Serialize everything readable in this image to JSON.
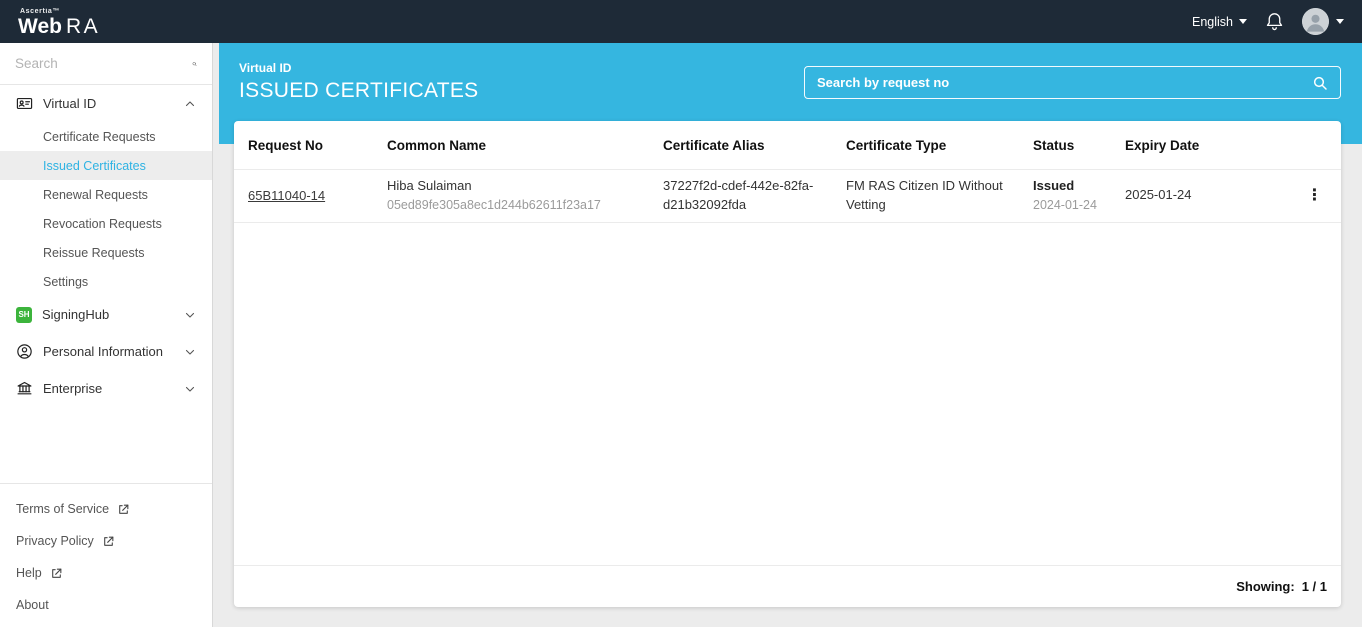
{
  "topbar": {
    "brand_ascertia": "Ascertia™",
    "brand_web": "Web",
    "brand_ra": "RA",
    "language_label": "English"
  },
  "sidebar": {
    "search_placeholder": "Search",
    "menu": {
      "virtual_id": {
        "label": "Virtual ID"
      },
      "signinghub": {
        "label": "SigningHub",
        "badge": "SH"
      },
      "personal_information": {
        "label": "Personal Information"
      },
      "enterprise": {
        "label": "Enterprise"
      }
    },
    "virtual_id_items": [
      {
        "label": "Certificate Requests",
        "selected": false
      },
      {
        "label": "Issued Certificates",
        "selected": true
      },
      {
        "label": "Renewal Requests",
        "selected": false
      },
      {
        "label": "Revocation Requests",
        "selected": false
      },
      {
        "label": "Reissue Requests",
        "selected": false
      },
      {
        "label": "Settings",
        "selected": false
      }
    ],
    "footer_links": [
      {
        "label": "Terms of Service",
        "external": true
      },
      {
        "label": "Privacy Policy",
        "external": true
      },
      {
        "label": "Help",
        "external": true
      },
      {
        "label": "About",
        "external": false
      }
    ]
  },
  "header": {
    "breadcrumb": "Virtual ID",
    "title": "ISSUED CERTIFICATES",
    "search_placeholder": "Search by request no"
  },
  "table": {
    "columns": [
      "Request No",
      "Common Name",
      "Certificate Alias",
      "Certificate Type",
      "Status",
      "Expiry Date"
    ],
    "rows": [
      {
        "request_no": "65B11040-14",
        "common_name": "Hiba Sulaiman",
        "common_name_id": "05ed89fe305a8ec1d244b62611f23a17",
        "certificate_alias": "37227f2d-cdef-442e-82fa-d21b32092fda",
        "certificate_type": "FM RAS Citizen ID Without Vetting",
        "status": "Issued",
        "status_date": "2024-01-24",
        "expiry_date": "2025-01-24",
        "actions_icon": "⋮"
      }
    ],
    "footer": {
      "showing_label": "Showing:",
      "showing_value": "1 / 1"
    }
  },
  "colors": {
    "topbar_bg": "#1e2a37",
    "accent_cyan": "#35b6e0",
    "selected_item_text": "#2fb3e3",
    "signinghub_green": "#3cb43c",
    "main_bg": "#ececec"
  }
}
